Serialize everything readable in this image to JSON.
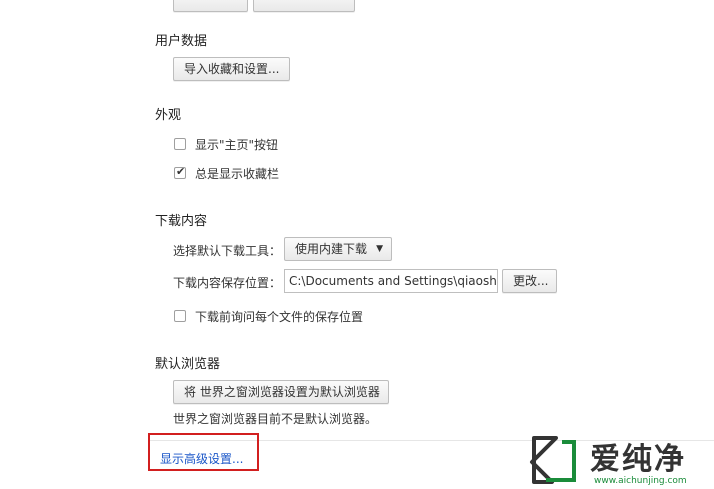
{
  "top": {
    "partial_buttons": [
      "",
      ""
    ]
  },
  "user_data": {
    "title": "用户数据",
    "import_button": "导入收藏和设置..."
  },
  "appearance": {
    "title": "外观",
    "show_home": {
      "label": "显示\"主页\"按钮",
      "checked": false
    },
    "show_bookmarks": {
      "label": "总是显示收藏栏",
      "checked": true
    }
  },
  "downloads": {
    "title": "下载内容",
    "tool_label": "选择默认下载工具：",
    "tool_value": "使用内建下载",
    "location_label": "下载内容保存位置：",
    "location_value": "C:\\Documents and Settings\\qiaoshiyu",
    "change_button": "更改...",
    "ask_each": {
      "label": "下载前询问每个文件的保存位置",
      "checked": false
    }
  },
  "default_browser": {
    "title": "默认浏览器",
    "set_button": "将 世界之窗浏览器设置为默认浏览器",
    "status": "世界之窗浏览器目前不是默认浏览器。"
  },
  "advanced_link": "显示高级设置...",
  "watermark": {
    "brand": "爱纯净",
    "url": "www.aichunjing.com",
    "accent": "#1a8c3a"
  },
  "colors": {
    "highlight": "#d21f1f",
    "link": "#1a56c8"
  }
}
